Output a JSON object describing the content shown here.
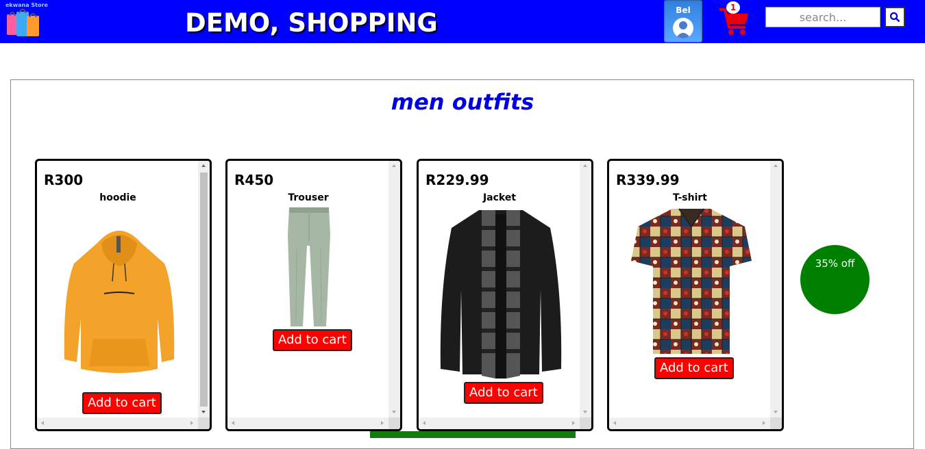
{
  "header": {
    "logo_text": "ekwana Store",
    "title": "DEMO, SHOPPING",
    "user_name": "Bel",
    "cart_count": "1",
    "search_placeholder": "search..."
  },
  "section": {
    "title": "men outfits"
  },
  "products": [
    {
      "price": "R300",
      "name": "hoodie",
      "button": "Add to cart",
      "image": "orange-hoodie"
    },
    {
      "price": "R450",
      "name": "Trouser",
      "button": "Add to cart",
      "image": "green-trouser"
    },
    {
      "price": "R229.99",
      "name": "Jacket",
      "button": "Add to cart",
      "image": "black-cardigan-jacket"
    },
    {
      "price": "R339.99",
      "name": "T-shirt",
      "button": "Add to cart",
      "image": "patterned-shirt"
    }
  ],
  "promo": {
    "text": "35% off",
    "color": "#008000"
  },
  "colors": {
    "header_bg": "#0000ff",
    "button_bg": "#ff0000",
    "section_title": "#0000e0"
  }
}
